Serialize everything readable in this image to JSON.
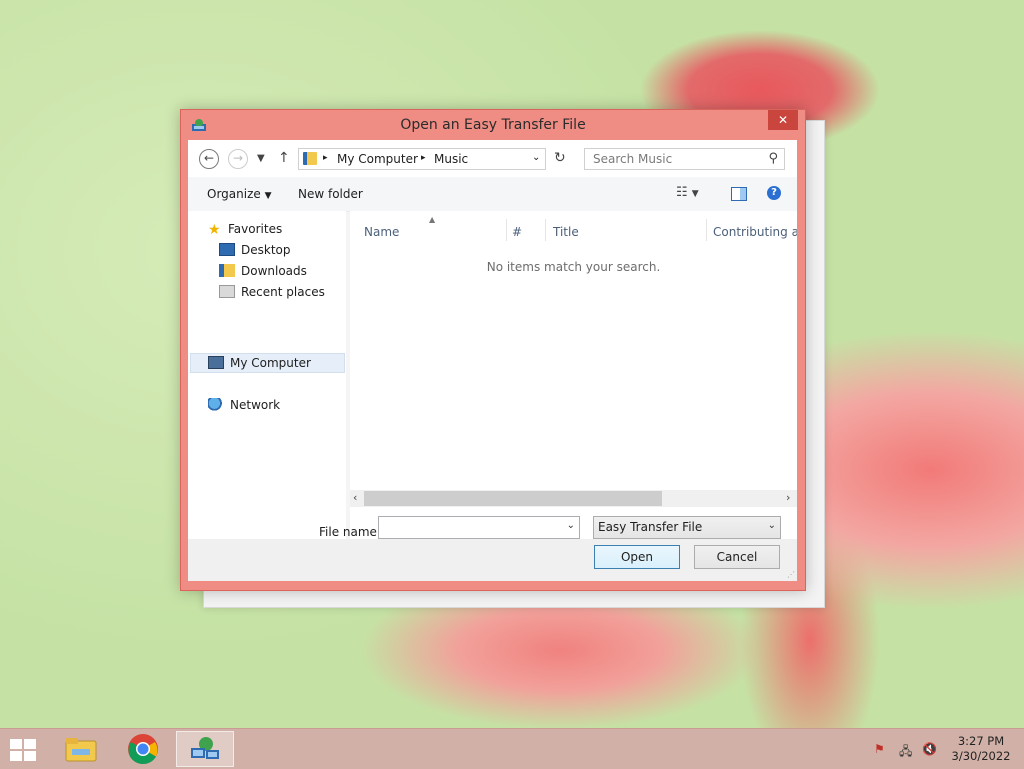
{
  "dialog": {
    "title": "Open an Easy Transfer File",
    "close_label": "✕"
  },
  "address_bar": {
    "breadcrumb": [
      "My Computer",
      "Music"
    ]
  },
  "search": {
    "placeholder": "Search Music"
  },
  "toolbar": {
    "organize_label": "Organize",
    "new_folder_label": "New folder"
  },
  "nav_pane": {
    "favorites_label": "Favorites",
    "favorites_items": [
      "Desktop",
      "Downloads",
      "Recent places"
    ],
    "computer_label": "My Computer",
    "network_label": "Network"
  },
  "file_list": {
    "columns": [
      "Name",
      "#",
      "Title",
      "Contributing art"
    ],
    "empty_message": "No items match your search."
  },
  "footer": {
    "file_name_label": "File name:",
    "file_name_value": "",
    "file_type_selected": "Easy Transfer File",
    "open_label": "Open",
    "cancel_label": "Cancel"
  },
  "taskbar": {
    "pinned": [
      "file-explorer-icon",
      "chrome-icon",
      "easy-transfer-icon"
    ],
    "clock_time": "3:27 PM",
    "clock_date": "3/30/2022"
  },
  "colors": {
    "dialog_frame": "#ef8d84",
    "close_button": "#c9453d",
    "selection": "#e5eef9"
  }
}
